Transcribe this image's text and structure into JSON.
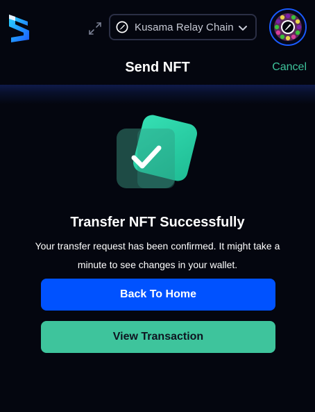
{
  "topbar": {
    "logo_icon": "subwallet-logo-icon",
    "expand_icon": "expand-arrows-icon",
    "network": {
      "label": "Kusama Relay Chain",
      "icon": "kusama-network-icon",
      "dropdown_icon": "chevron-down-icon"
    },
    "avatar_icon": "account-identicon-icon"
  },
  "header": {
    "title": "Send NFT",
    "cancel_label": "Cancel"
  },
  "result": {
    "icon": "checkmark-success-icon",
    "title": "Transfer NFT Successfully",
    "message": "Your transfer request has been confirmed. It might take a minute to see changes in your wallet."
  },
  "actions": {
    "back_home_label": "Back To Home",
    "view_transaction_label": "View Transaction"
  },
  "colors": {
    "background": "#04060f",
    "primary": "#0052ff",
    "accent": "#3ec49c",
    "border": "#2b2f45"
  }
}
